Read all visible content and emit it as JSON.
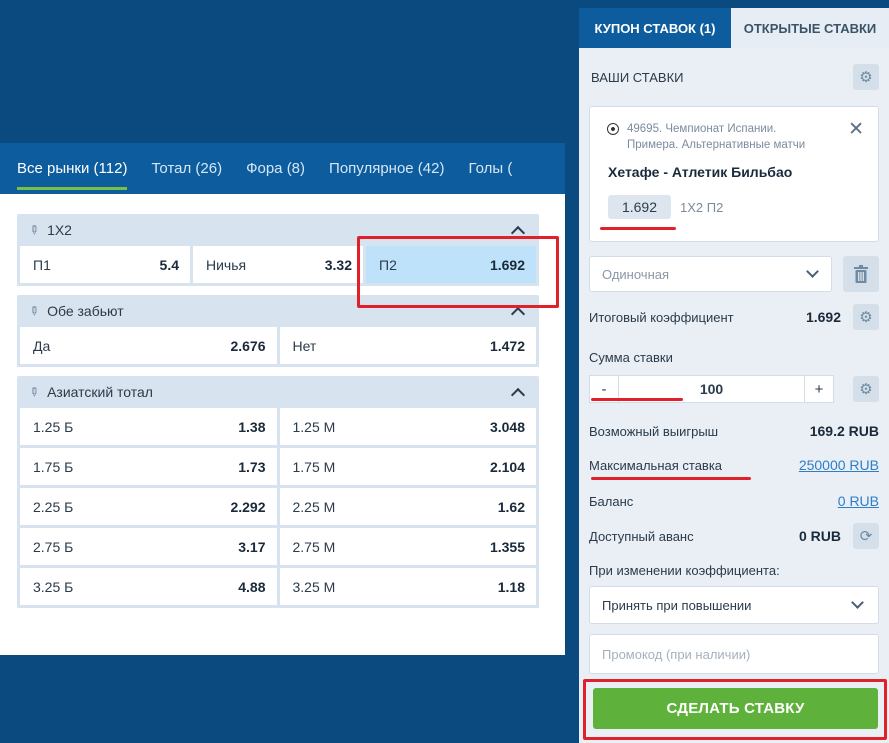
{
  "markets": {
    "tabs": [
      {
        "label": "Все рынки (112)",
        "active": true
      },
      {
        "label": "Тотал (26)",
        "active": false
      },
      {
        "label": "Фора (8)",
        "active": false
      },
      {
        "label": "Популярное (42)",
        "active": false
      },
      {
        "label": "Голы (",
        "active": false
      }
    ],
    "groups": [
      {
        "title": "1X2",
        "rows": [
          [
            {
              "label": "П1",
              "odd": "5.4"
            },
            {
              "label": "Ничья",
              "odd": "3.32"
            },
            {
              "label": "П2",
              "odd": "1.692",
              "selected": true
            }
          ]
        ]
      },
      {
        "title": "Обе забьют",
        "rows": [
          [
            {
              "label": "Да",
              "odd": "2.676"
            },
            {
              "label": "Нет",
              "odd": "1.472"
            }
          ]
        ]
      },
      {
        "title": "Азиатский тотал",
        "rows": [
          [
            {
              "label": "1.25 Б",
              "odd": "1.38"
            },
            {
              "label": "1.25 М",
              "odd": "3.048"
            }
          ],
          [
            {
              "label": "1.75 Б",
              "odd": "1.73"
            },
            {
              "label": "1.75 М",
              "odd": "2.104"
            }
          ],
          [
            {
              "label": "2.25 Б",
              "odd": "2.292"
            },
            {
              "label": "2.25 М",
              "odd": "1.62"
            }
          ],
          [
            {
              "label": "2.75 Б",
              "odd": "3.17"
            },
            {
              "label": "2.75 М",
              "odd": "1.355"
            }
          ],
          [
            {
              "label": "3.25 Б",
              "odd": "4.88"
            },
            {
              "label": "3.25 М",
              "odd": "1.18"
            }
          ]
        ]
      }
    ]
  },
  "slip": {
    "tab_coupon": "КУПОН СТАВОК (1)",
    "tab_open": "ОТКРЫТЫЕ СТАВКИ",
    "your_bets": "ВАШИ СТАВКИ",
    "bet": {
      "league": "49695. Чемпионат Испании. Примера. Альтернативные матчи",
      "match": "Хетафе - Атлетик Бильбао",
      "odd": "1.692",
      "odd_type": "1X2 П2"
    },
    "bet_type": "Одиночная",
    "total_odds_label": "Итоговый коэффициент",
    "total_odds_value": "1.692",
    "stake_label": "Сумма ставки",
    "stake_minus": "-",
    "stake_value": "100",
    "stake_plus": "+",
    "win_label": "Возможный выигрыш",
    "win_value": "169.2 RUB",
    "max_label": "Максимальная ставка",
    "max_value": "250000 RUB",
    "balance_label": "Баланс",
    "balance_value": "0 RUB",
    "advance_label": "Доступный аванс",
    "advance_value": "0 RUB",
    "odds_change_label": "При изменении коэффициента:",
    "odds_change_value": "Принять при повышении",
    "promo_placeholder": "Промокод (при наличии)",
    "make_bet": "СДЕЛАТЬ СТАВКУ"
  },
  "colors": {
    "background": "#0b4a7e",
    "tabs_bar": "#0d5d9e",
    "active_underline": "#76c043",
    "selected_cell": "#bfe2fb",
    "annotation_red": "#e1212a",
    "make_bet_green": "#5eb13a",
    "link_blue": "#2e7ec8"
  },
  "icons": [
    "pin-icon",
    "chevron-up-icon",
    "gear-icon",
    "football-icon",
    "close-icon",
    "chevron-down-icon",
    "trash-icon",
    "refresh-icon"
  ]
}
